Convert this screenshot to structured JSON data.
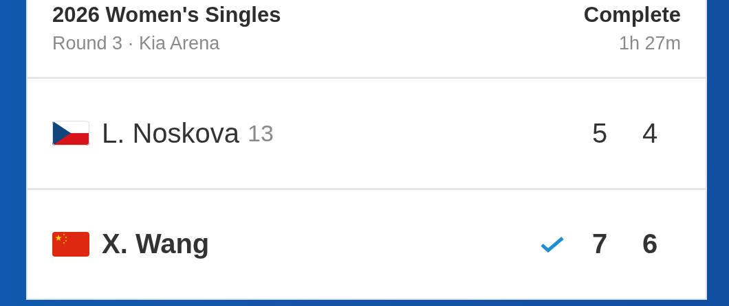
{
  "event": {
    "title": "2026 Women's Singles",
    "subtitle": "Round 3 · Kia Arena",
    "status": "Complete",
    "duration": "1h 27m"
  },
  "players": [
    {
      "kind": "cz",
      "name": "L. Noskova",
      "seed": "13",
      "winner": false,
      "scores": [
        "5",
        "4"
      ]
    },
    {
      "kind": "cn",
      "name": "X. Wang",
      "winner": true,
      "scores": [
        "7",
        "6"
      ]
    }
  ]
}
